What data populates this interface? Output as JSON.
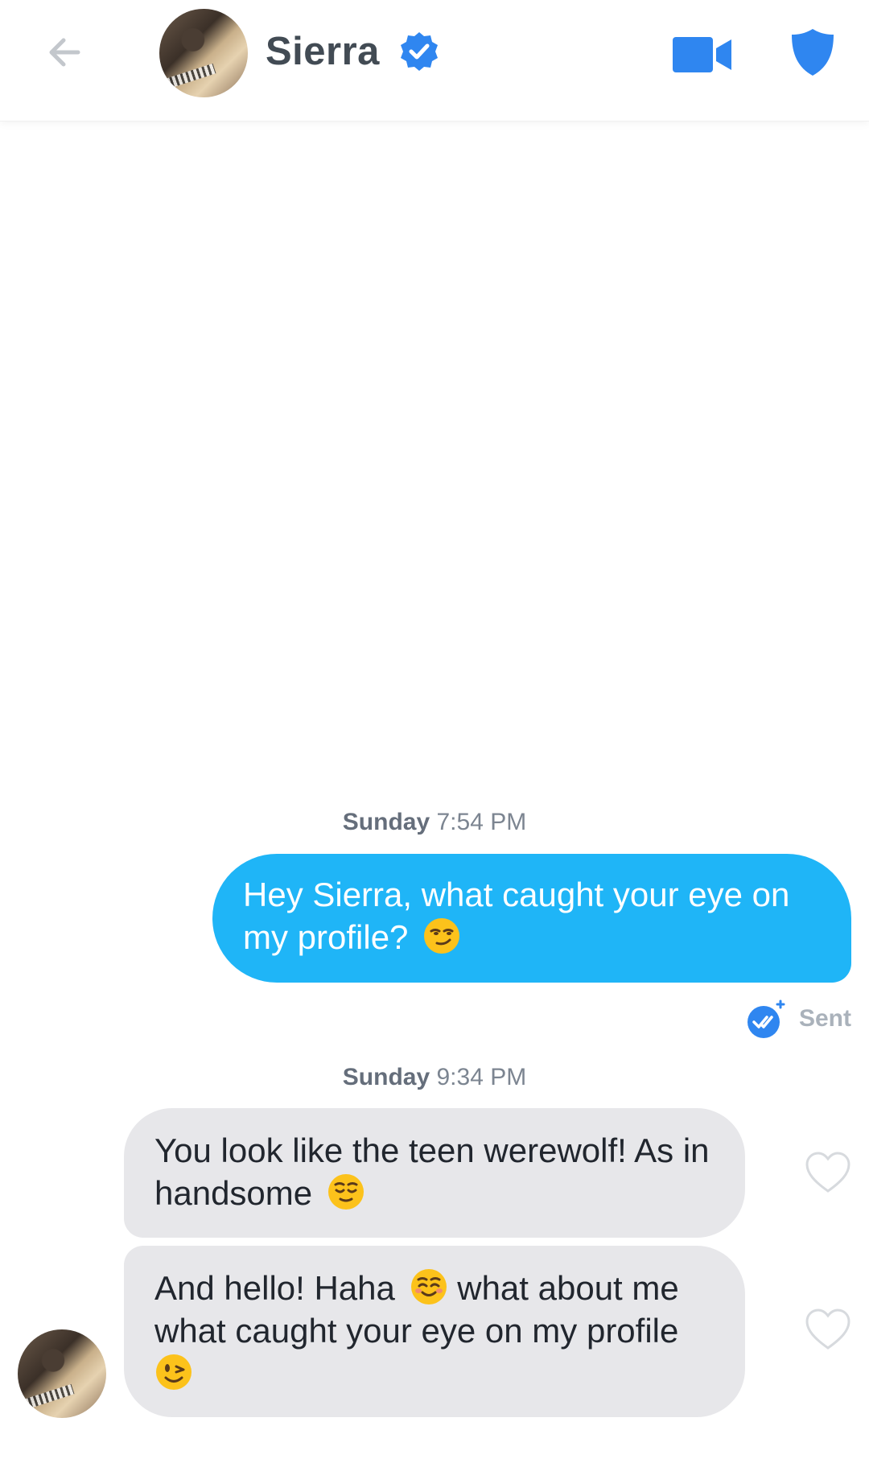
{
  "header": {
    "contact_name": "Sierra"
  },
  "messages": [
    {
      "timestamp_day": "Sunday",
      "timestamp_time": "7:54 PM",
      "direction": "outgoing",
      "text": "Hey Sierra, what caught your eye on my profile?",
      "emoji": "smirking-face",
      "status": "Sent"
    },
    {
      "timestamp_day": "Sunday",
      "timestamp_time": "9:34 PM",
      "direction": "incoming",
      "text": "You look like the teen werewolf! As in handsome",
      "emoji": "relieved-face"
    },
    {
      "direction": "incoming",
      "text_part1": "And hello! Haha",
      "emoji_mid": "smiling-face",
      "text_part2": "what about me what caught your eye on my profile",
      "emoji_end": "winking-face"
    }
  ],
  "colors": {
    "outgoing_bubble": "#1fb5f7",
    "incoming_bubble": "#e7e7ea",
    "accent_blue": "#2f86f0",
    "icon_gray": "#c3c7cc"
  }
}
